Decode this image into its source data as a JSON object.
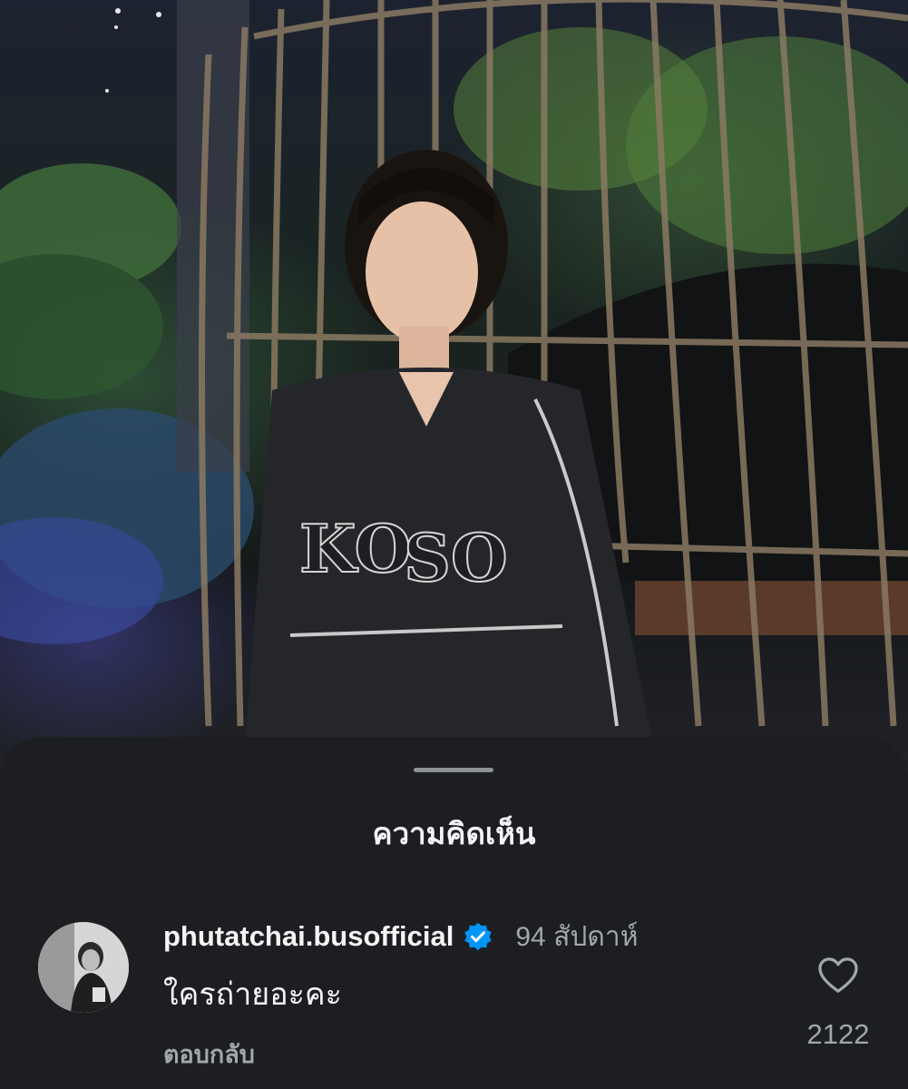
{
  "sheet": {
    "title": "ความคิดเห็น"
  },
  "comment": {
    "username": "phutatchai.busofficial",
    "verified": true,
    "timestamp": "94 สัปดาห์",
    "text": "ใครถ่ายอะคะ",
    "reply_label": "ตอบกลับ",
    "like_count": "2122"
  },
  "icons": {
    "verified": "verified-badge-icon",
    "like": "heart-outline-icon",
    "handle": "drag-handle"
  },
  "colors": {
    "sheet_background": "#1c1e22",
    "verified_blue": "#0095f6",
    "primary_text": "#f5f5f5",
    "secondary_text": "#a3a6ab"
  }
}
